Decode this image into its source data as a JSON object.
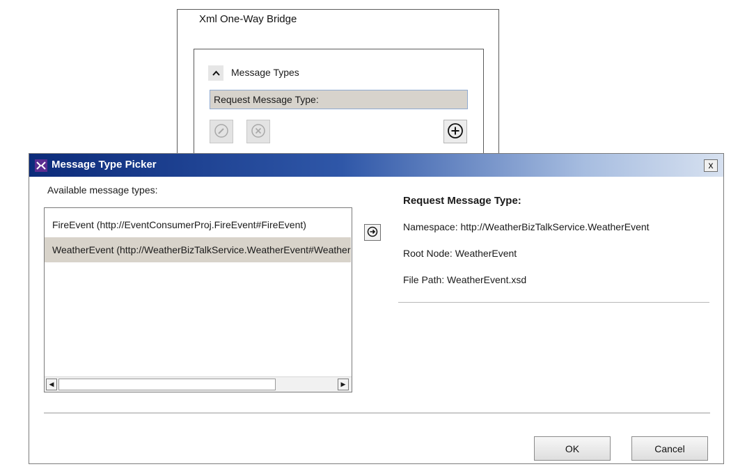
{
  "bridge": {
    "title": "Xml One-Way Bridge",
    "section_label": "Message Types",
    "request_field_value": "Request Message Type:",
    "icons": {
      "collapse": "chevron-up-icon",
      "edit": "pencil-icon",
      "remove": "remove-icon",
      "add": "add-icon"
    }
  },
  "dialog": {
    "title": "Message Type Picker",
    "close_label": "x",
    "available_label": "Available message types:",
    "list_items": [
      {
        "label": "FireEvent (http://EventConsumerProj.FireEvent#FireEvent)"
      },
      {
        "label": "WeatherEvent (http://WeatherBizTalkService.WeatherEvent#WeatherEvent)"
      }
    ],
    "selected_index": 1,
    "details": {
      "title": "Request Message Type:",
      "namespace": "Namespace: http://WeatherBizTalkService.WeatherEvent",
      "root_node": "Root Node: WeatherEvent",
      "file_path": "File Path: WeatherEvent.xsd"
    },
    "buttons": {
      "ok": "OK",
      "cancel": "Cancel"
    },
    "colors": {
      "titlebar_start": "#0c2b7a",
      "selection": "#d8d3ca"
    }
  }
}
